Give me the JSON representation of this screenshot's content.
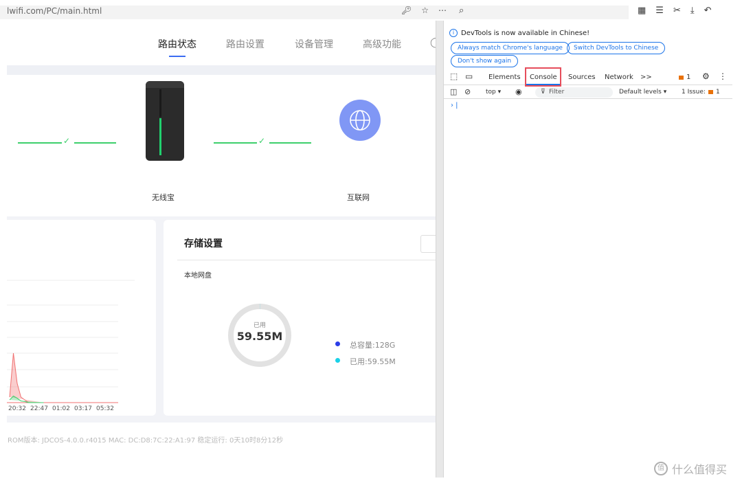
{
  "browser": {
    "url": "lwifi.com/PC/main.html",
    "left_icons": [
      "key-icon",
      "star-icon",
      "more-icon"
    ],
    "right_icons": [
      "grid-icon",
      "collections-icon",
      "scissors-icon",
      "download-icon",
      "undo-icon"
    ]
  },
  "router": {
    "nav": [
      {
        "label": "路由状态",
        "active": true
      },
      {
        "label": "路由设置",
        "active": false
      },
      {
        "label": "设备管理",
        "active": false
      },
      {
        "label": "高级功能",
        "active": false
      }
    ],
    "topology": {
      "router_label": "无线宝",
      "internet_label": "互联网"
    },
    "chart_data": {
      "type": "line",
      "x": [
        "20:32",
        "22:47",
        "01:02",
        "03:17",
        "05:32"
      ],
      "series": [
        {
          "color": "#f07070",
          "values": [
            0.1,
            0.9,
            0.35,
            0.1,
            0.05,
            0,
            0,
            0,
            0,
            0
          ]
        },
        {
          "color": "#3ccf6b",
          "values": [
            0.05,
            0.12,
            0.08,
            0.03,
            0.02,
            0,
            0,
            0,
            0,
            0
          ]
        }
      ]
    },
    "storage": {
      "title": "存储设置",
      "local_disk": "本地网盘",
      "used_label": "已用",
      "used_value": "59.55M",
      "used_fraction": 0.0005,
      "legend_total": "总容量:128G",
      "legend_used": "已用:59.55M",
      "total_color": "#2b3de8",
      "used_color": "#1ad1e8"
    },
    "footer": "ROM版本: JDCOS-4.0.0.r4015    MAC: DC:D8:7C:22:A1:97    稳定运行: 0天10时8分12秒"
  },
  "devtools": {
    "info_text": "DevTools is now available in Chinese!",
    "btn_match": "Always match Chrome's language",
    "btn_switch": "Switch DevTools to Chinese",
    "btn_dont_show": "Don't show again",
    "tabs": [
      "Elements",
      "Console",
      "Sources",
      "Network",
      ">>"
    ],
    "issues_badge": "1",
    "context": "top ▾",
    "filter_placeholder": "Filter",
    "levels": "Default levels ▾",
    "issues_text": "1 Issue:",
    "issues_count": "1",
    "prompt": "› |"
  },
  "watermark": "什么值得买"
}
